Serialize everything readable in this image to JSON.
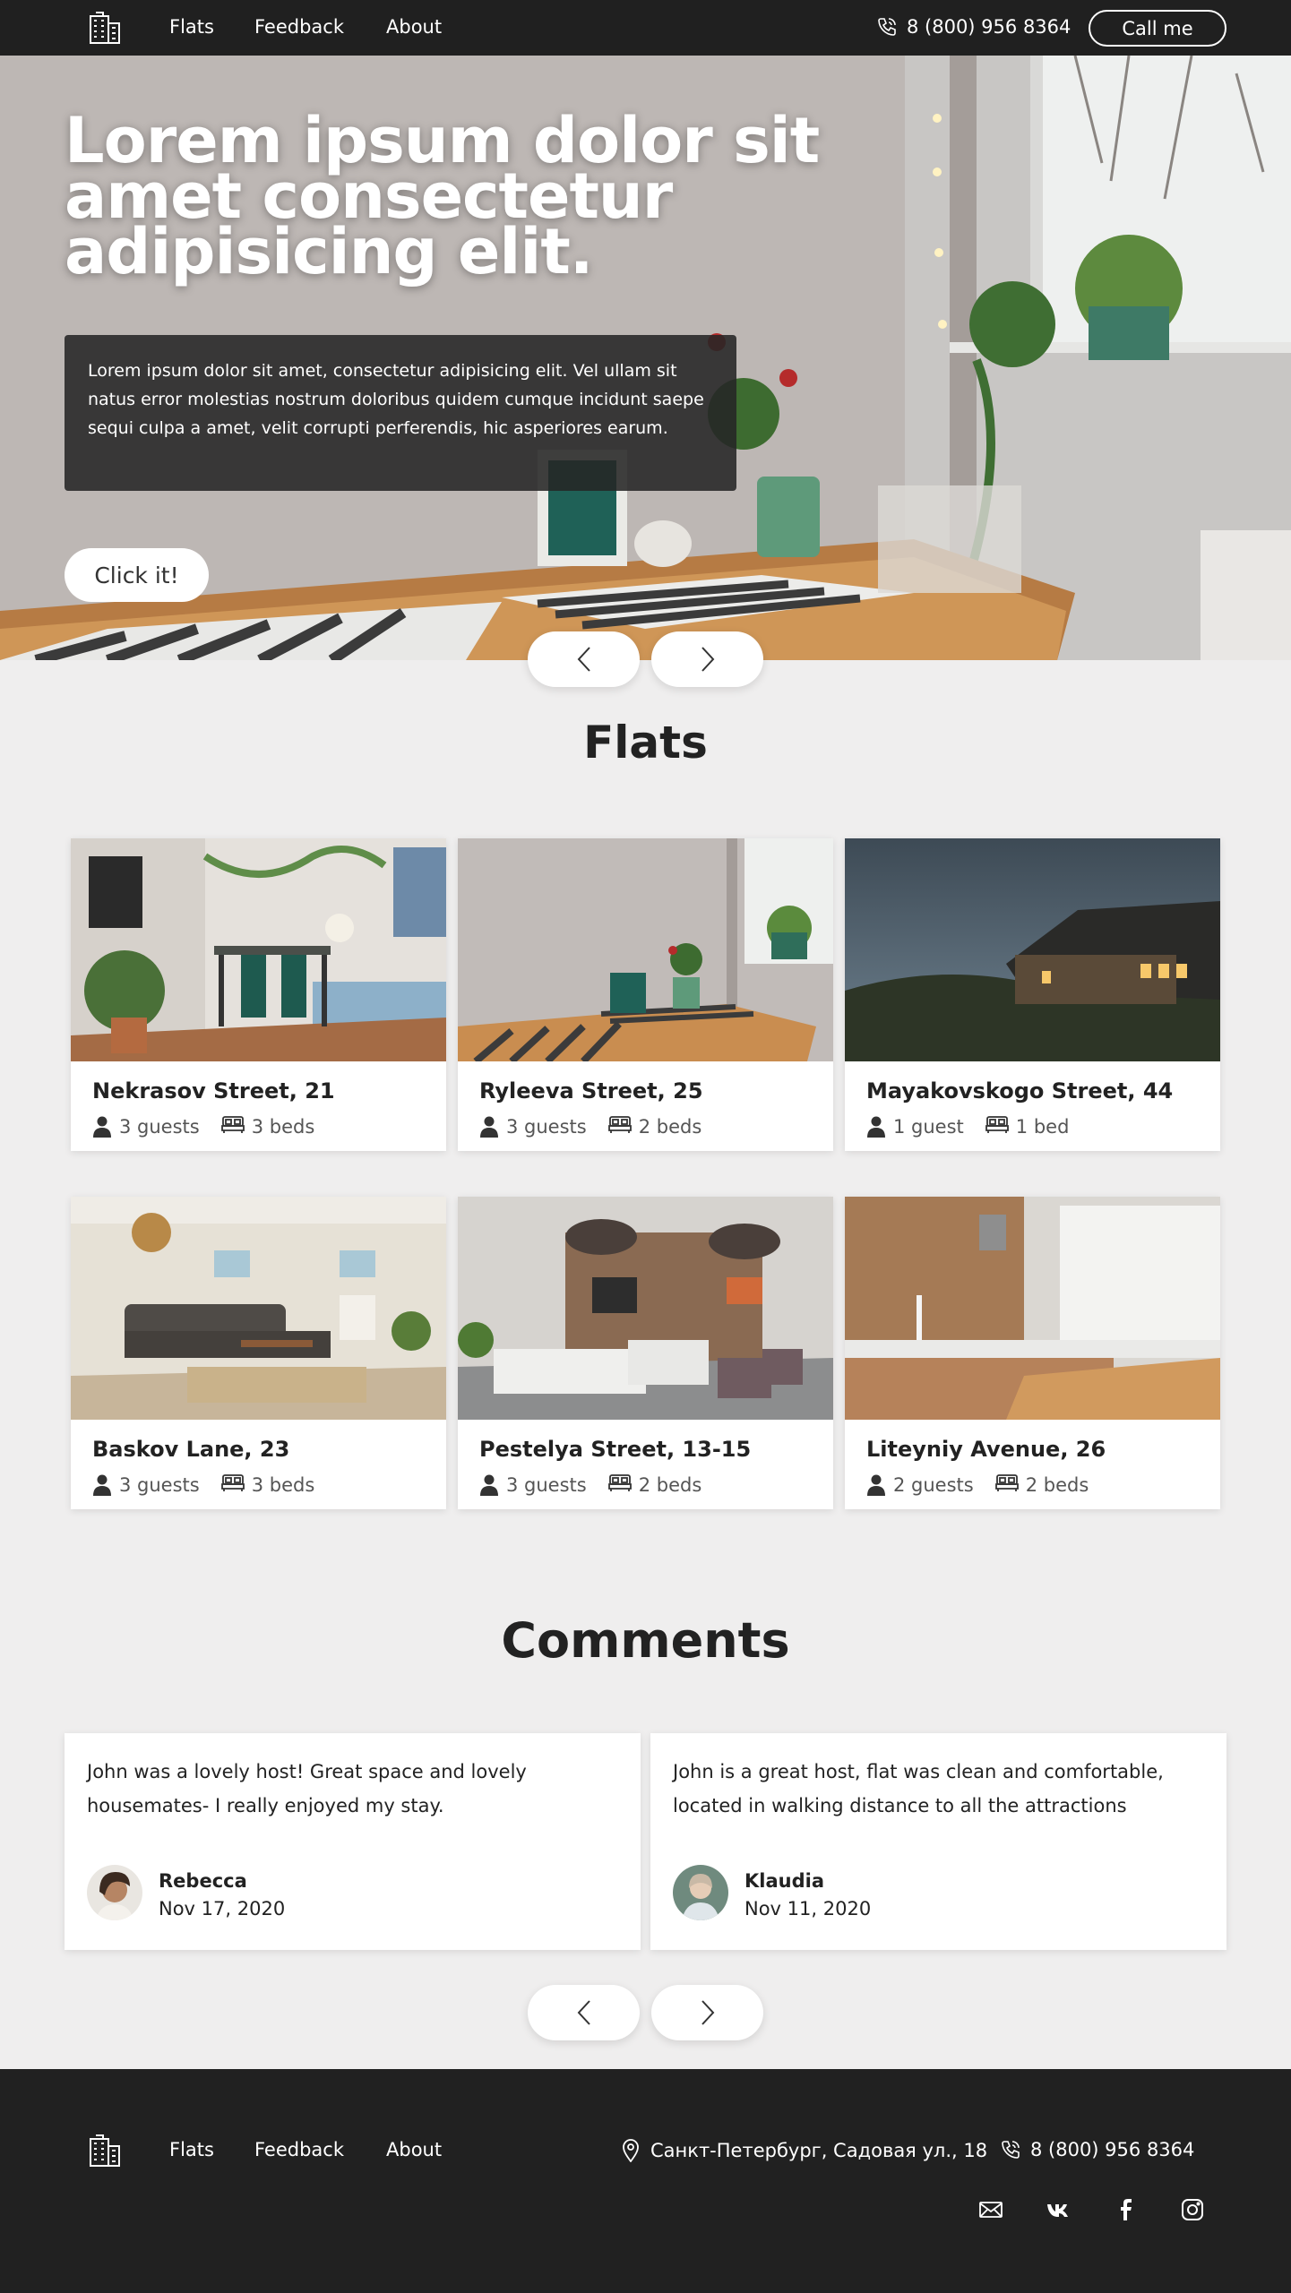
{
  "header": {
    "nav": [
      "Flats",
      "Feedback",
      "About"
    ],
    "phone": "8 (800) 956 8364",
    "call_button": "Call me"
  },
  "hero": {
    "title": "Lorem ipsum dolor sit amet consectetur adipisicing elit.",
    "text": "Lorem ipsum dolor sit amet, consectetur adipisicing elit. Vel ullam sit natus error molestias nostrum doloribus quidem cumque incidunt saepe sequi culpa a amet, velit corrupti perferendis, hic asperiores earum.",
    "button": "Click it!"
  },
  "flats": {
    "title": "Flats",
    "items": [
      {
        "address": "Nekrasov Street, 21",
        "guests": "3 guests",
        "beds": "3 beds"
      },
      {
        "address": "Ryleeva Street, 25",
        "guests": "3 guests",
        "beds": "2 beds"
      },
      {
        "address": "Mayakovskogo Street, 44",
        "guests": "1 guest",
        "beds": "1 bed"
      },
      {
        "address": "Baskov Lane, 23",
        "guests": "3 guests",
        "beds": "3 beds"
      },
      {
        "address": "Pestelya Street, 13-15",
        "guests": "3 guests",
        "beds": "2 beds"
      },
      {
        "address": "Liteyniy Avenue, 26",
        "guests": "2 guests",
        "beds": "2 beds"
      }
    ]
  },
  "comments": {
    "title": "Comments",
    "items": [
      {
        "text": "John was a lovely host! Great space and lovely housemates- I really enjoyed my stay.",
        "name": "Rebecca",
        "date": "Nov 17, 2020"
      },
      {
        "text": "John is a great host, flat was clean and comfortable, located in walking distance to all the attractions",
        "name": "Klaudia",
        "date": "Nov 11, 2020"
      }
    ]
  },
  "footer": {
    "nav": [
      "Flats",
      "Feedback",
      "About"
    ],
    "address": "Санкт-Петербург, Садовая ул., 18",
    "phone": "8 (800) 956 8364",
    "socials": [
      "mail-icon",
      "vk-icon",
      "facebook-icon",
      "instagram-icon"
    ]
  }
}
